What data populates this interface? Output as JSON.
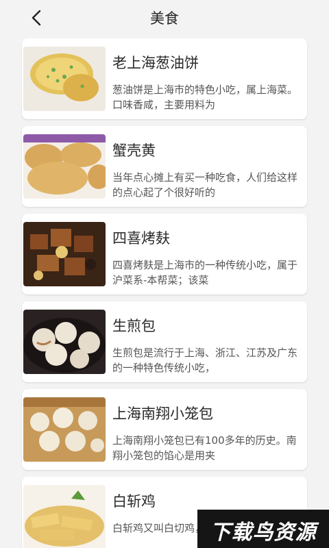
{
  "header": {
    "title": "美食",
    "back_icon": "chevron-left-icon"
  },
  "items": [
    {
      "name": "老上海葱油饼",
      "desc": "葱油饼是上海市的特色小吃，属上海菜。口味香咸，主要用料为"
    },
    {
      "name": "蟹壳黄",
      "desc": "当年点心摊上有买一种吃食，人们给这样的点心起了个很好听的"
    },
    {
      "name": "四喜烤麸",
      "desc": "四喜烤麸是上海市的一种传统小吃，属于沪菜系-本帮菜；该菜"
    },
    {
      "name": "生煎包",
      "desc": "生煎包是流行于上海、浙江、江苏及广东的一种特色传统小吃，"
    },
    {
      "name": "上海南翔小笼包",
      "desc": "上海南翔小笼包已有100多年的历史。南翔小笼包的馅心是用夹"
    },
    {
      "name": "白斩鸡",
      "desc": "白斩鸡又叫白切鸡，是一道中华民族特色"
    }
  ],
  "watermark": {
    "text": "下载鸟资源"
  }
}
